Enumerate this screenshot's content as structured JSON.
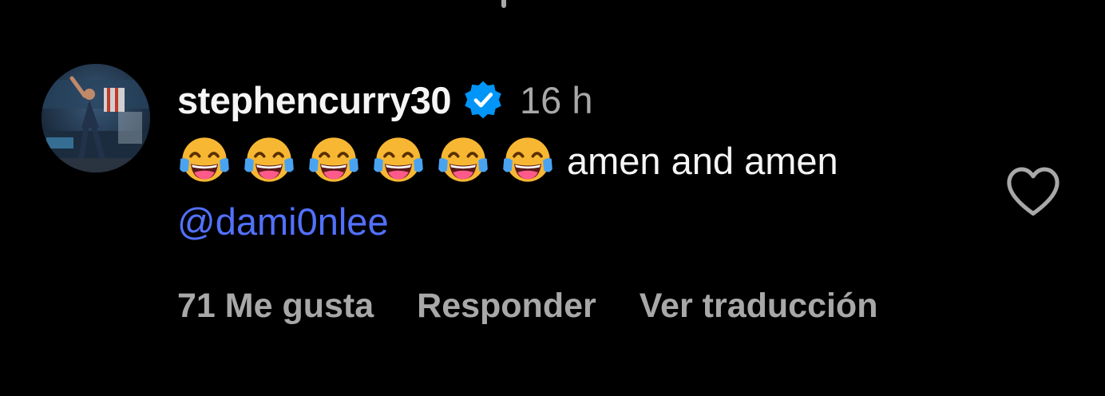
{
  "comment": {
    "username": "stephencurry30",
    "verified": true,
    "timestamp": "16 h",
    "emojis": [
      "face-with-tears-of-joy-icon",
      "face-with-tears-of-joy-icon",
      "face-with-tears-of-joy-icon",
      "face-with-tears-of-joy-icon",
      "face-with-tears-of-joy-icon",
      "face-with-tears-of-joy-icon"
    ],
    "text": "amen and amen",
    "mention": "@dami0nlee",
    "likes_label": "71 Me gusta",
    "reply_label": "Responder",
    "translate_label": "Ver traducción"
  },
  "icons": {
    "verified": "verified-badge-icon",
    "like": "heart-outline-icon"
  },
  "colors": {
    "background": "#000000",
    "primary_text": "#f5f5f5",
    "secondary_text": "#a8a8a8",
    "mention": "#5271ff",
    "verified": "#0095f6"
  }
}
